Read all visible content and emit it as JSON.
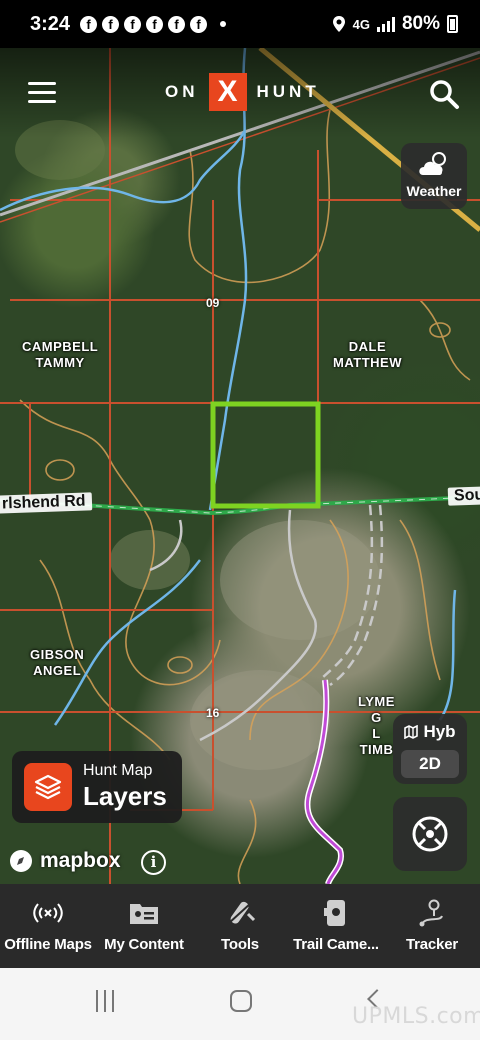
{
  "status_bar": {
    "time": "3:24",
    "notification_icons": [
      "facebook-icon",
      "facebook-icon",
      "facebook-icon",
      "facebook-icon",
      "facebook-icon",
      "facebook-icon"
    ],
    "notification_glyph": "f",
    "network": "4G",
    "battery": "80%"
  },
  "header": {
    "brand_left": "ON",
    "brand_mark": "X",
    "brand_right": "HUNT"
  },
  "map": {
    "owners": [
      {
        "line1": "CAMPBELL",
        "line2": "TAMMY"
      },
      {
        "line1": "DALE",
        "line2": "MATTHEW"
      },
      {
        "line1": "GIBSON",
        "line2": "ANGEL"
      }
    ],
    "partial_owner": {
      "line1": "LYME",
      "line2": "G",
      "line3": "L",
      "line4": "TIMB"
    },
    "road_left": "rlshend Rd",
    "road_right": "Sou",
    "section_numbers": [
      "09",
      "16"
    ],
    "attribution": "mapbox",
    "info_glyph": "i"
  },
  "weather_button": {
    "label": "Weather"
  },
  "map_mode": {
    "label": "Hyb",
    "dimension": "2D"
  },
  "layers_button": {
    "line1": "Hunt Map",
    "line2": "Layers"
  },
  "bottom_nav": [
    {
      "label": "Offline Maps",
      "icon": "offline-icon"
    },
    {
      "label": "My Content",
      "icon": "folder-icon"
    },
    {
      "label": "Tools",
      "icon": "tools-icon"
    },
    {
      "label": "Trail Came...",
      "icon": "trail-camera-icon"
    },
    {
      "label": "Tracker",
      "icon": "tracker-icon"
    }
  ],
  "watermark": "UPMLS.com",
  "colors": {
    "brand_orange": "#e8461e",
    "selection_green": "#7ed321",
    "parcel_line": "#c9502e",
    "contour": "#d8a258",
    "stream": "#6fb6e8",
    "track": "#c04bd6"
  }
}
